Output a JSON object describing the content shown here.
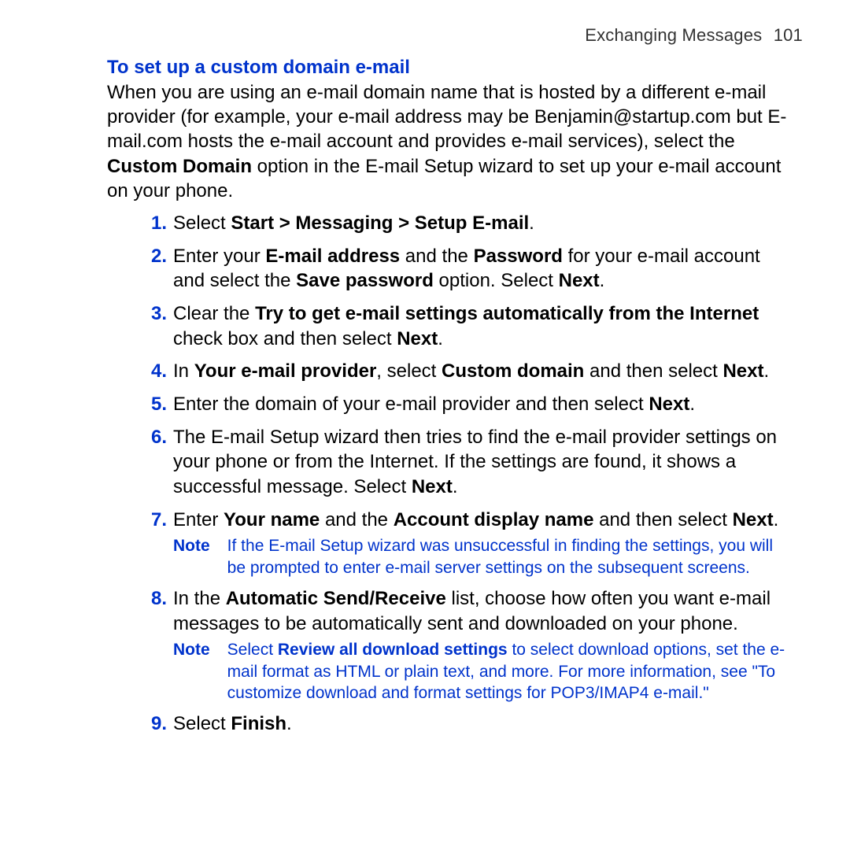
{
  "header": {
    "chapter": "Exchanging Messages",
    "page": "101"
  },
  "heading": "To set up a custom domain e-mail",
  "intro": {
    "pre": "When you are using an e-mail domain name that is hosted by a different e-mail provider (for example, your e-mail address may be Benjamin@startup.com but E-mail.com hosts the e-mail account and provides e-mail services), select the ",
    "bold1": "Custom Domain",
    "post": " option in the E-mail Setup wizard to set up your e-mail account on your phone."
  },
  "steps": {
    "n1": "1.",
    "s1_a": "Select ",
    "s1_b": "Start > Messaging > Setup E-mail",
    "s1_c": ".",
    "n2": "2.",
    "s2_a": "Enter your ",
    "s2_b": "E-mail address",
    "s2_c": " and the ",
    "s2_d": "Password",
    "s2_e": " for your e-mail account and select the ",
    "s2_f": "Save password",
    "s2_g": " option. Select ",
    "s2_h": "Next",
    "s2_i": ".",
    "n3": "3.",
    "s3_a": "Clear the ",
    "s3_b": "Try to get e-mail settings automatically from the Internet",
    "s3_c": " check box and then select ",
    "s3_d": "Next",
    "s3_e": ".",
    "n4": "4.",
    "s4_a": "In ",
    "s4_b": "Your e-mail provider",
    "s4_c": ", select ",
    "s4_d": "Custom domain",
    "s4_e": " and then select ",
    "s4_f": "Next",
    "s4_g": ".",
    "n5": "5.",
    "s5_a": "Enter the domain of your e-mail provider and then select ",
    "s5_b": "Next",
    "s5_c": ".",
    "n6": "6.",
    "s6_a": "The E-mail Setup wizard then tries to find the e-mail provider settings on your phone or from the Internet. If the settings are found, it shows a successful message. Select ",
    "s6_b": "Next",
    "s6_c": ".",
    "n7": "7.",
    "s7_a": "Enter ",
    "s7_b": "Your name",
    "s7_c": " and the ",
    "s7_d": "Account display name",
    "s7_e": " and then select ",
    "s7_f": "Next",
    "s7_g": ".",
    "note1_label": "Note",
    "note1_body": "If the E-mail Setup wizard was unsuccessful in finding the settings, you will be prompted to enter e-mail server settings on the subsequent screens.",
    "n8": "8.",
    "s8_a": "In the ",
    "s8_b": "Automatic Send/Receive",
    "s8_c": " list, choose how often you want e-mail messages to be automatically sent and downloaded on your phone.",
    "note2_label": "Note",
    "note2_a": "Select ",
    "note2_b": "Review all download settings",
    "note2_c": " to select download options, set the e-mail format as HTML or plain text, and more. For more information, see \"To customize download and format settings for POP3/IMAP4 e-mail.\"",
    "n9": "9.",
    "s9_a": "Select ",
    "s9_b": "Finish",
    "s9_c": "."
  }
}
